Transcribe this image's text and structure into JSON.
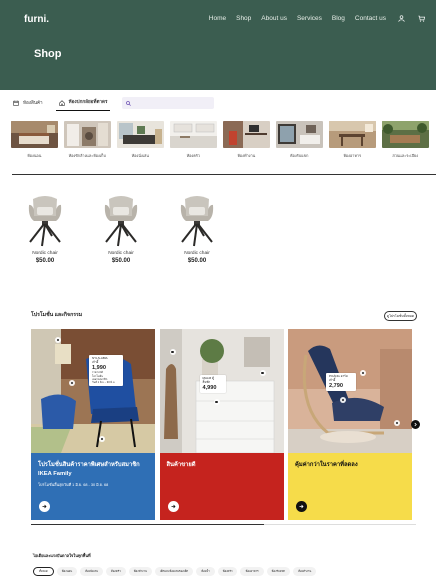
{
  "brand": {
    "logo": "furni.",
    "header_color": "#3b5d50"
  },
  "nav": {
    "items": [
      "Home",
      "Shop",
      "About us",
      "Services",
      "Blog",
      "Contact us"
    ],
    "icons": [
      "user-icon",
      "cart-icon"
    ]
  },
  "page": {
    "title": "Shop"
  },
  "tabs": [
    {
      "label": "ห้องสินค้า",
      "icon": "calendar-icon"
    },
    {
      "label": "ห้องปกกลัยอที่ตาดร",
      "icon": "home-icon",
      "active": true
    }
  ],
  "search": {
    "value": "",
    "placeholder": ""
  },
  "rooms": [
    {
      "label": "ห้องนอน"
    },
    {
      "label": "ห้องซักล้างและห้องเก็บ"
    },
    {
      "label": "ห้องนั่งเล่น"
    },
    {
      "label": "ห้องครัว"
    },
    {
      "label": "ห้องทำงาน"
    },
    {
      "label": "ห้องรับแขก"
    },
    {
      "label": "ห้องอาหาร"
    },
    {
      "label": "สวนและระเบียง"
    }
  ],
  "products": [
    {
      "name": "Nordic chair",
      "price": "$50.00"
    },
    {
      "name": "Nordic chair",
      "price": "$50.00"
    },
    {
      "name": "Nordic chair",
      "price": "$50.00"
    }
  ],
  "promo": {
    "title": "โปรโมชั่น และกิจกรรม",
    "more_label": "ดูโปรโมชั่นทั้งหมด",
    "cards": [
      {
        "title": "โปรโมชั่นสินค้าราคาพิเศษสำหรับสมาชิก IKEA Family",
        "subtitle": "โปรโมชั่นสิ้นสุดวันที่ 1 มิ.ย. 68 - 30 มิ.ย. 68",
        "tag_name": "NYLS-ABIA",
        "tag_desc": "เก้าอี้",
        "tag_price": "1,990",
        "tag_extra": "ราคาปกติ\nโปรโมชั่น\nเฉพาะสมาชิก\nวันที่ 1 มิ.ย. - 30 มิ.ย.",
        "bg": "#2f6fb5",
        "text_color": "#ffffff"
      },
      {
        "title": "สินค้าขายดี",
        "subtitle": "",
        "tag_name": "MALM ตู้",
        "tag_desc": "ลิ้นชัก",
        "tag_price": "4,990",
        "tag_extra": "",
        "bg": "#c5231e",
        "text_color": "#ffffff"
      },
      {
        "title": "คุ้มค่ากว่าในราคาที่ลดลง",
        "subtitle": "",
        "tag_name": "POÄNG อาร์ม",
        "tag_desc": "เก้าอี้",
        "tag_price": "2,790",
        "tag_extra": "",
        "bg": "#f6dc4a",
        "text_color": "#111111"
      }
    ]
  },
  "filters": {
    "title": "ไอเดียและแรงบันดาลใจในทุกพื้นที่",
    "chips": [
      "ทั้งหมด",
      "ห้องนอน",
      "ห้องนั่งเล่น",
      "ห้องครัว",
      "ห้องทำงาน",
      "เด็กและห้องเล่นของเด็ก",
      "ห้องน้ำ",
      "ห้องครัว",
      "ห้องอาหาร",
      "ห้องรับแขก",
      "ห้องทำงาน"
    ]
  }
}
